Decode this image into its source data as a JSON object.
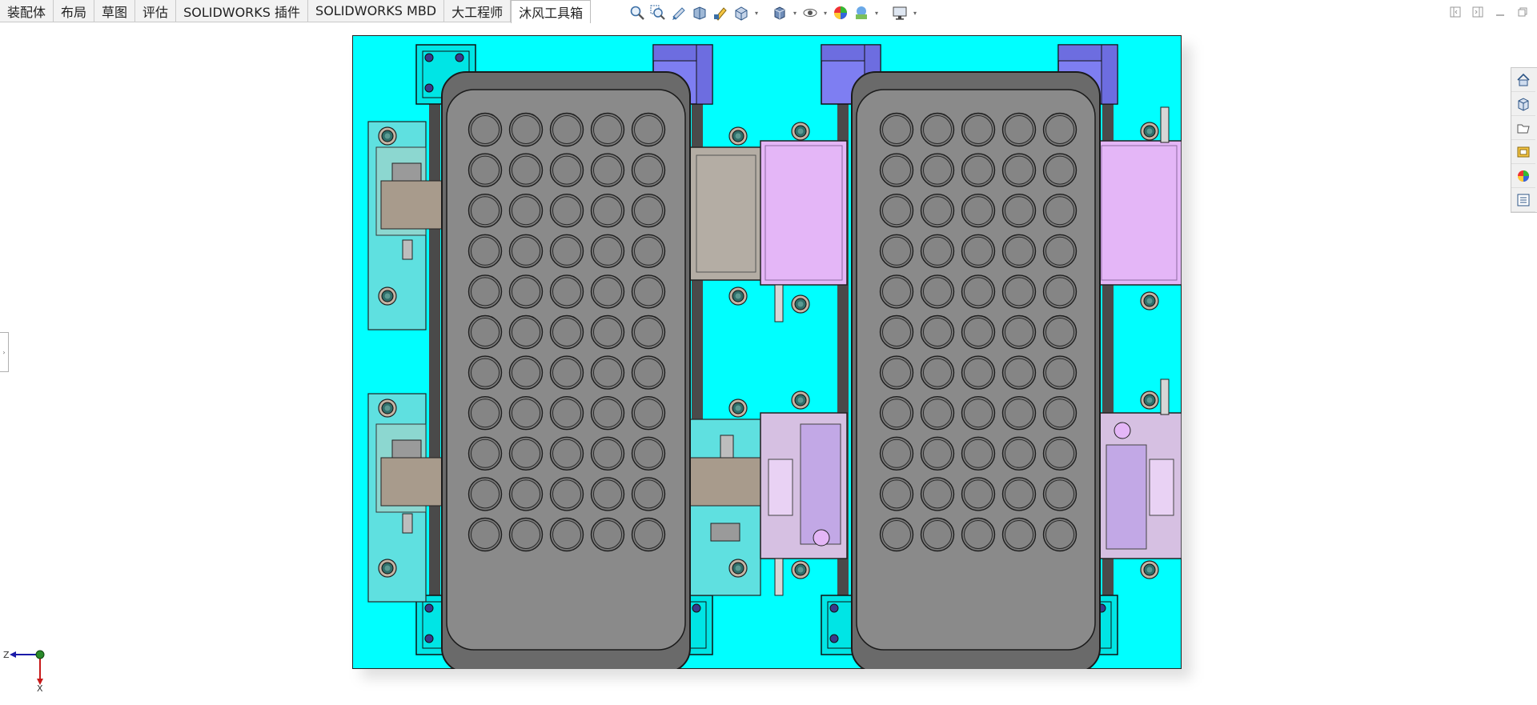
{
  "tabs": [
    {
      "label": "装配体",
      "active": false
    },
    {
      "label": "布局",
      "active": false
    },
    {
      "label": "草图",
      "active": false
    },
    {
      "label": "评估",
      "active": false
    },
    {
      "label": "SOLIDWORKS 插件",
      "active": false
    },
    {
      "label": "SOLIDWORKS MBD",
      "active": false
    },
    {
      "label": "大工程师",
      "active": false
    },
    {
      "label": "沐风工具箱",
      "active": true
    }
  ],
  "heads_up_toolbar": [
    "zoom-to-fit-icon",
    "zoom-to-area-icon",
    "previous-view-icon",
    "section-view-icon",
    "dynamic-annotation-icon",
    "view-orientation-icon",
    "display-style-icon",
    "hide-show-items-icon",
    "edit-appearance-icon",
    "apply-scene-icon",
    "view-settings-icon"
  ],
  "window_controls": [
    "tile-left-icon",
    "tile-right-icon",
    "minimize-icon",
    "restore-icon"
  ],
  "task_pane": [
    "home-icon",
    "design-library-icon",
    "file-explorer-icon",
    "view-palette-icon",
    "appearances-icon",
    "custom-properties-icon"
  ],
  "triad": {
    "axis_z": "Z",
    "axis_x": "X"
  },
  "colors": {
    "base_plate": "#00ffff",
    "tray": "#7d7d7d",
    "tray_inner": "#8a8a8a",
    "clamp_block": "#7e7ef2",
    "cylinder": "#e4b6f7",
    "stopper": "#b4ada4",
    "mount_pad": "#c4b4a4"
  }
}
